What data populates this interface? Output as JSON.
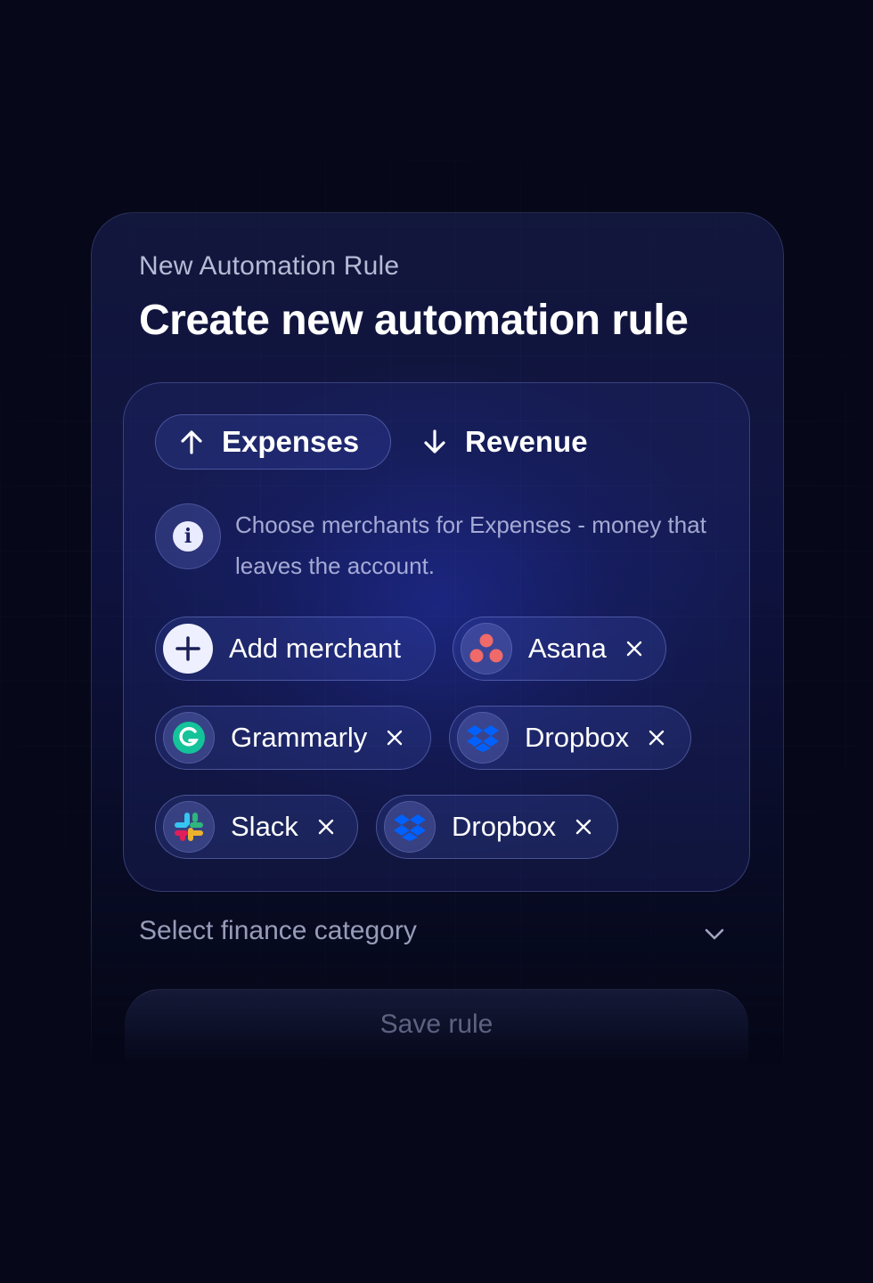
{
  "header": {
    "eyebrow": "New Automation Rule",
    "title": "Create new automation rule"
  },
  "tabs": [
    {
      "label": "Expenses",
      "icon": "arrow-up-icon",
      "selected": true
    },
    {
      "label": "Revenue",
      "icon": "arrow-down-icon",
      "selected": false
    }
  ],
  "info": {
    "icon": "info-icon",
    "text": "Choose merchants for Expenses - money that leaves the account."
  },
  "add_merchant": {
    "label": "Add merchant",
    "icon": "plus-icon"
  },
  "merchants": [
    {
      "label": "Asana",
      "icon": "asana-logo-icon"
    },
    {
      "label": "Grammarly",
      "icon": "grammarly-logo-icon"
    },
    {
      "label": "Dropbox",
      "icon": "dropbox-logo-icon"
    },
    {
      "label": "Slack",
      "icon": "slack-logo-icon"
    },
    {
      "label": "Dropbox",
      "icon": "dropbox-logo-icon"
    }
  ],
  "category": {
    "placeholder": "Select finance category",
    "icon": "chevron-down-icon"
  },
  "save": {
    "label": "Save rule"
  },
  "colors": {
    "background": "#060819",
    "accent_glow": "#2838e6",
    "asana": "#f06a6a",
    "grammarly": "#15c39a",
    "dropbox": "#0061fe"
  }
}
